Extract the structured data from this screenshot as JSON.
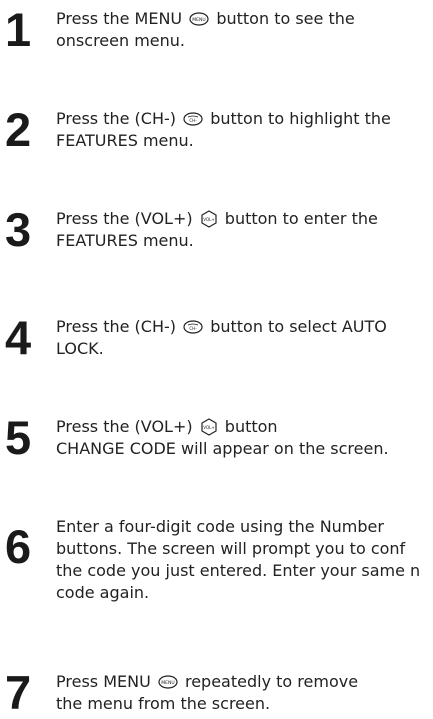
{
  "steps": [
    {
      "number": "1",
      "line1_before": "Press the MENU",
      "line1_after": "button to see the",
      "line2": "onscreen menu.",
      "icon": "menu-button-icon",
      "icon_label": "MENU"
    },
    {
      "number": "2",
      "line1_before": "Press the (CH-)",
      "line1_after": "button to highlight the",
      "line2": "FEATURES menu.",
      "icon": "ch-minus-button-icon",
      "icon_label": "CH-"
    },
    {
      "number": "3",
      "line1_before": "Press the (VOL+)",
      "line1_after": "button to enter the",
      "line2": "FEATURES menu.",
      "icon": "vol-plus-button-icon",
      "icon_label": "VOL+"
    },
    {
      "number": "4",
      "line1_before": "Press the (CH-)",
      "line1_after": "button to select AUTO",
      "line2": "LOCK.",
      "icon": "ch-minus-button-icon",
      "icon_label": "CH-"
    },
    {
      "number": "5",
      "line1_before": "Press the (VOL+)",
      "line1_after": "button",
      "line2": "CHANGE CODE will appear on the screen.",
      "icon": "vol-plus-button-icon",
      "icon_label": "VOL+"
    },
    {
      "number": "6",
      "line1": "Enter a four-digit code using the Number",
      "line2": "buttons. The screen will prompt you to conf",
      "line3": "the code you just entered. Enter your same n",
      "line4": "code again."
    },
    {
      "number": "7",
      "line1_before": "Press MENU",
      "line1_after": "repeatedly to remove",
      "line2": "the menu from the screen.",
      "icon": "menu-button-icon",
      "icon_label": "MENU"
    }
  ]
}
